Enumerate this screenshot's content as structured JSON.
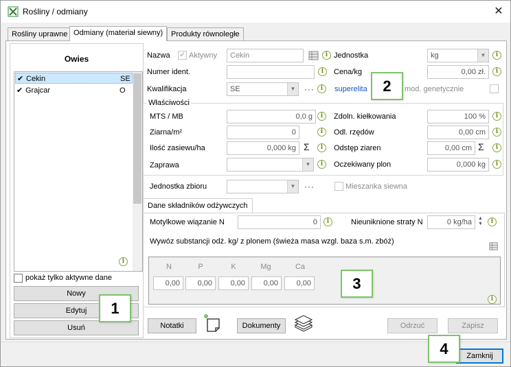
{
  "window": {
    "title": "Rośliny / odmiany"
  },
  "tabs": [
    {
      "label": "Rośliny uprawne"
    },
    {
      "label": "Odmiany (materiał siewny)"
    },
    {
      "label": "Produkty równoległe"
    }
  ],
  "left": {
    "crop": "Owies",
    "varieties": [
      {
        "check": "✔",
        "name": "Cekin",
        "code": "SE"
      },
      {
        "check": "✔",
        "name": "Grajcar",
        "code": "O"
      }
    ],
    "only_active_label": "pokaż tylko aktywne dane",
    "buttons": {
      "new": "Nowy",
      "edit": "Edytuj",
      "delete": "Usuń"
    }
  },
  "form": {
    "name_label": "Nazwa",
    "active_label": "Aktywny",
    "name_value": "Cekin",
    "id_label": "Numer ident.",
    "qualification_label": "Kwalifikacja",
    "qualification_value": "SE",
    "dots": "···",
    "unit_label": "Jednostka",
    "unit_value": "kg",
    "price_label": "Cena/kg",
    "price_value": "0,00 zł.",
    "superelite": "superelita",
    "genetic_label": "mod. genetycznie",
    "properties_title": "Właściwości",
    "mts_label": "MTS / MB",
    "mts_value": "0,0 g",
    "grains_label": "Ziarna/m²",
    "grains_value": "0",
    "sowing_label": "Ilość zasiewu/ha",
    "sowing_value": "0,000 kg",
    "dressing_label": "Zaprawa",
    "germ_label": "Zdoln. kiełkowania",
    "germ_value": "100 %",
    "row_label": "Odl. rzędów",
    "row_value": "0,00 cm",
    "grain_dist_label": "Odstęp ziaren",
    "grain_dist_value": "0,00 cm",
    "yield_label": "Oczekiwany plon",
    "yield_value": "0,000 kg",
    "harvest_unit_label": "Jednostka zbioru",
    "mix_label": "Mieszanka siewna",
    "sigma": "Σ"
  },
  "nutrients": {
    "tab_label": "Dane składników odżywczych",
    "fixation_label": "Motylkowe wiązanie N",
    "fixation_value": "0",
    "loss_label": "Nieuniknione straty N",
    "loss_value": "0 kg/ha",
    "removal_label": "Wywóz substancji odż. kg/ z plonem (świeża masa wzgl. baza s.m. zbóż)",
    "columns": [
      "N",
      "P",
      "K",
      "Mg",
      "Ca"
    ],
    "values": [
      "0,00",
      "0,00",
      "0,00",
      "0,00",
      "0,00"
    ]
  },
  "bottom": {
    "notes": "Notatki",
    "documents": "Dokumenty",
    "cancel": "Odrzuć",
    "save": "Zapisz",
    "close": "Zamknij"
  },
  "markers": [
    "1",
    "2",
    "3",
    "4"
  ],
  "colors": {
    "accent": "#0078d7",
    "marker_border": "#7ec36a",
    "selection": "#cce8ff",
    "link": "#1a55c2"
  }
}
